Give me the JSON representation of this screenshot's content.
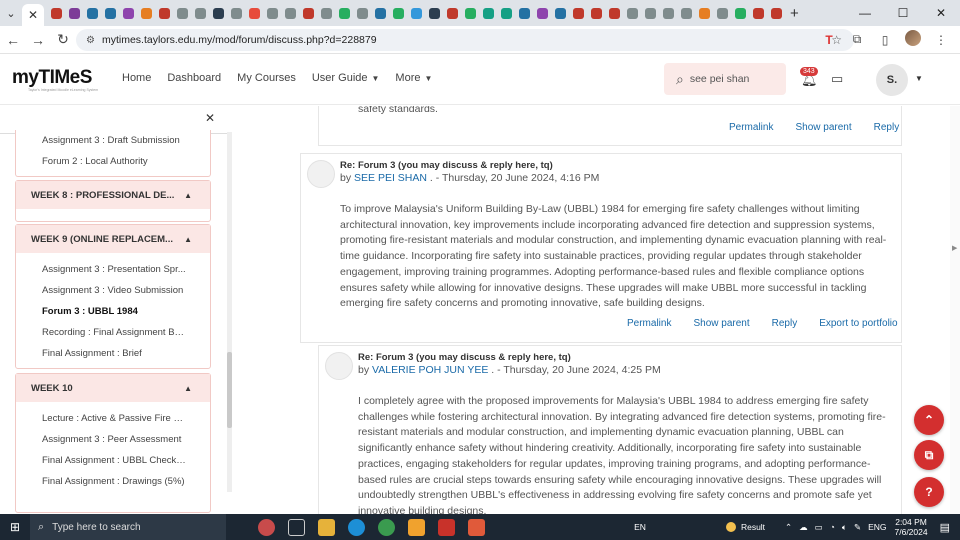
{
  "browser": {
    "url": "mytimes.taylors.edu.my/mod/forum/discuss.php?d=228879",
    "tab_close": "✕",
    "new_tab": "+",
    "tab_colors": [
      "#c0392b",
      "#7d3c98",
      "#2471a3",
      "#2471a3",
      "#8e44ad",
      "#e67e22",
      "#c0392b",
      "#7f8c8d",
      "#7f8c8d",
      "#2c3e50",
      "#7f8c8d",
      "#e74c3c",
      "#7f8c8d",
      "#7f8c8d",
      "#c0392b",
      "#7f8c8d",
      "#27ae60",
      "#7f8c8d",
      "#2471a3",
      "#27ae60",
      "#3498db",
      "#2c3e50",
      "#c0392b",
      "#27ae60",
      "#16a085",
      "#16a085",
      "#2471a3",
      "#8e44ad",
      "#2471a3",
      "#c0392b",
      "#c0392b",
      "#c0392b",
      "#7f8c8d",
      "#7f8c8d",
      "#7f8c8d",
      "#7f8c8d",
      "#e67e22",
      "#7f8c8d",
      "#27ae60",
      "#c0392b",
      "#c0392b"
    ]
  },
  "site": {
    "logo": "myTIMeS",
    "logo_tagline": "Taylor's Integrated Moodle eLearning System",
    "nav": {
      "home": "Home",
      "dashboard": "Dashboard",
      "courses": "My Courses",
      "user_guide": "User Guide",
      "more": "More"
    },
    "search_value": "see pei shan",
    "notification_count": "343",
    "user_initial": "S."
  },
  "drawer": {
    "top_items": [
      "Assignment 3 : Draft Submission",
      "Forum 2 : Local Authority"
    ],
    "week8_title": "WEEK 8 : PROFESSIONAL DE...",
    "week9_title": "WEEK 9 (ONLINE REPLACEM...",
    "week9_items": [
      "Assignment 3 : Presentation Spr...",
      "Assignment 3 : Video Submission",
      "Forum 3 : UBBL 1984",
      "Recording : Final Assignment Bri...",
      "Final Assignment : Brief"
    ],
    "week10_title": "WEEK 10",
    "week10_items": [
      "Lecture : Active & Passive Fire S...",
      "Assignment 3 : Peer Assessment",
      "Final Assignment : UBBL Checkli...",
      "Final Assignment : Drawings (5%)"
    ]
  },
  "posts": {
    "top_fragment": "safety standards.",
    "links": {
      "permalink": "Permalink",
      "show_parent": "Show parent",
      "reply": "Reply",
      "export": "Export to portfolio"
    },
    "post1": {
      "title": "Re: Forum 3 (you may discuss & reply here, tq)",
      "by_prefix": "by",
      "author": "SEE PEI SHAN",
      "date": " . - Thursday, 20 June 2024, 4:16 PM",
      "body": "To improve Malaysia's Uniform Building By-Law (UBBL) 1984 for emerging fire safety challenges without limiting architectural innovation, key improvements include incorporating advanced fire detection and suppression systems, promoting fire-resistant materials and modular construction, and implementing dynamic evacuation planning with real-time guidance. Incorporating fire safety into sustainable practices, providing regular updates through stakeholder engagement, improving training programmes. Adopting performance-based rules and flexible compliance options ensures safety while allowing for innovative designs. These upgrades will make UBBL more successful in tackling emerging fire safety concerns and promoting innovative, safe building designs."
    },
    "post2": {
      "title": "Re: Forum 3 (you may discuss & reply here, tq)",
      "by_prefix": "by",
      "author": "VALERIE POH JUN YEE",
      "date": " . - Thursday, 20 June 2024, 4:25 PM",
      "body": "I completely agree with the proposed improvements for Malaysia's UBBL 1984 to address emerging fire safety challenges while fostering architectural innovation. By integrating advanced fire detection systems, promoting fire-resistant materials and modular construction, and implementing dynamic evacuation planning, UBBL can significantly enhance safety without hindering creativity. Additionally, incorporating fire safety into sustainable practices, engaging stakeholders for regular updates, improving training programs, and adopting performance-based rules are crucial steps towards ensuring safety while encouraging innovative designs. These upgrades will undoubtedly strengthen UBBL's effectiveness in addressing evolving fire safety concerns and promote safe yet innovative building designs."
    }
  },
  "taskbar": {
    "search_placeholder": "Type here to search",
    "weather": "Result",
    "lang": "EN",
    "kb_lang": "ENG",
    "time": "2:04 PM",
    "date": "7/6/2024"
  }
}
